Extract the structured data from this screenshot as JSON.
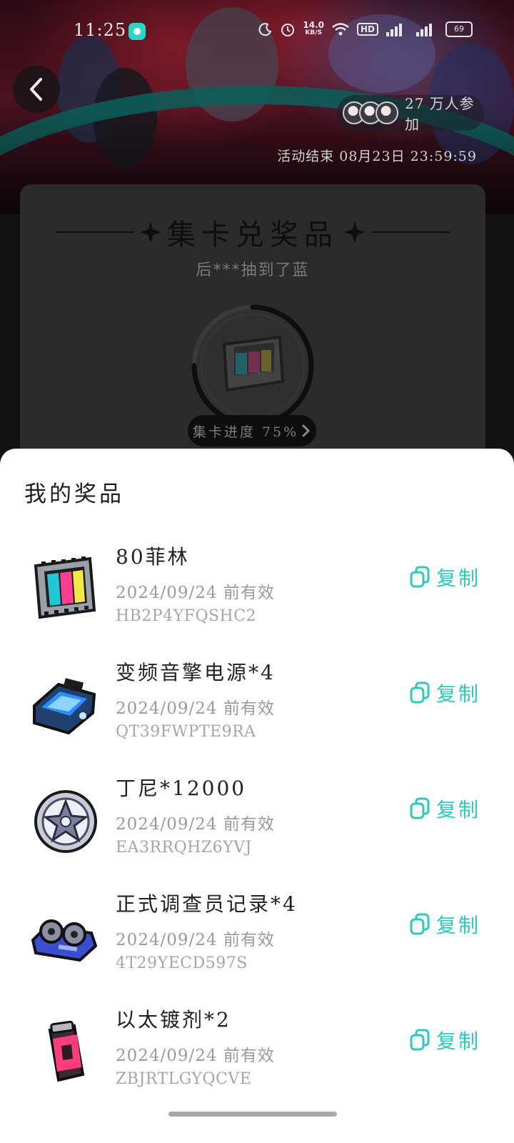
{
  "status_bar": {
    "time": "11:25",
    "net_speed_value": "14.0",
    "net_speed_unit": "KB/S",
    "hd_badge": "HD",
    "battery": "69"
  },
  "header": {
    "participants": "27 万人参加",
    "end_time": "活动结束 08月23日 23:59:59"
  },
  "card": {
    "title": "集卡兑奖品",
    "ticker": "后***抽到了蓝",
    "progress_label": "集卡进度 75%",
    "progress_value": 0.75
  },
  "sheet": {
    "title": "我的奖品",
    "copy_label": "复制",
    "prizes": [
      {
        "name": "80菲林",
        "validity": "2024/09/24 前有效",
        "code": "HB2P4YFQSHC2",
        "icon": "film-icon"
      },
      {
        "name": "变频音擎电源*4",
        "validity": "2024/09/24 前有效",
        "code": "QT39FWPTE9RA",
        "icon": "power-supply-icon"
      },
      {
        "name": "丁尼*12000",
        "validity": "2024/09/24 前有效",
        "code": "EA3RRQHZ6YVJ",
        "icon": "coin-icon"
      },
      {
        "name": "正式调查员记录*4",
        "validity": "2024/09/24 前有效",
        "code": "4T29YECD597S",
        "icon": "tape-reel-icon"
      },
      {
        "name": "以太镀剂*2",
        "validity": "2024/09/24 前有效",
        "code": "ZBJRTLGYQCVE",
        "icon": "spray-can-icon"
      }
    ]
  },
  "colors": {
    "accent": "#2cc9bc",
    "sheet_bg": "#ffffff",
    "card_bg": "#2b2b2b"
  }
}
